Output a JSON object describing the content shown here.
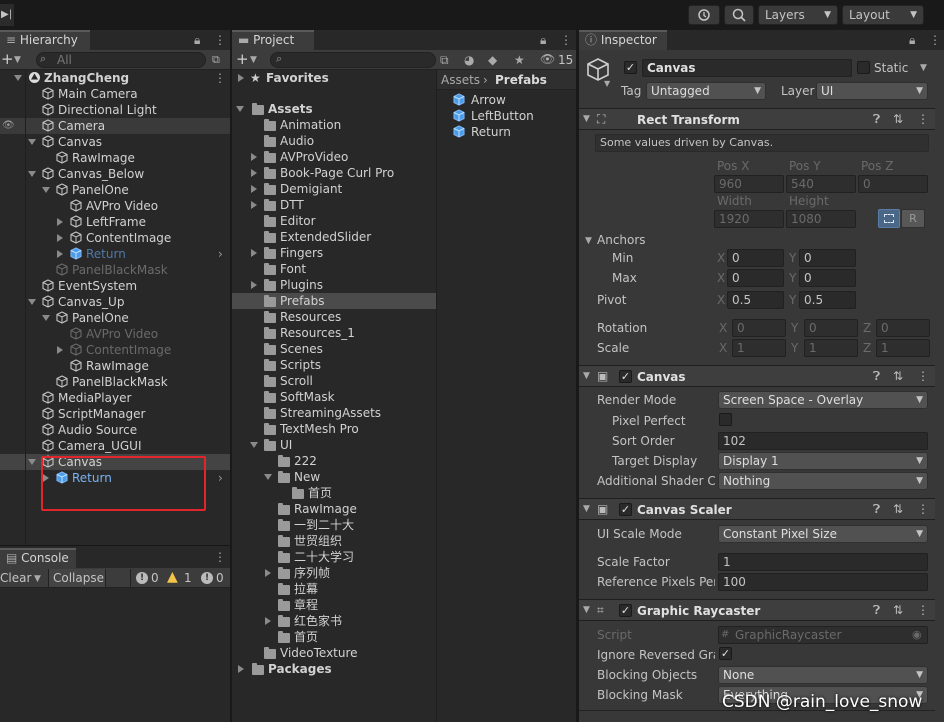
{
  "toolbar": {
    "layers": "Layers",
    "layout": "Layout"
  },
  "hierarchy": {
    "tab": "Hierarchy",
    "search": "All",
    "items": [
      {
        "label": "ZhangCheng",
        "indent": 0,
        "kind": "scene",
        "expanded": true,
        "active": true,
        "bold": true
      },
      {
        "label": "Main Camera",
        "indent": 1,
        "kind": "go",
        "active": true
      },
      {
        "label": "Directional Light",
        "indent": 1,
        "kind": "go",
        "active": true
      },
      {
        "label": "Camera",
        "indent": 1,
        "kind": "go",
        "active": true,
        "hover": true
      },
      {
        "label": "Canvas",
        "indent": 1,
        "kind": "go",
        "expanded": true,
        "active": true
      },
      {
        "label": "RawImage",
        "indent": 2,
        "kind": "go",
        "active": true
      },
      {
        "label": "Canvas_Below",
        "indent": 1,
        "kind": "go",
        "expanded": true,
        "active": true
      },
      {
        "label": "PanelOne",
        "indent": 2,
        "kind": "go",
        "expanded": true,
        "active": true
      },
      {
        "label": "AVPro Video",
        "indent": 3,
        "kind": "go",
        "active": true
      },
      {
        "label": "LeftFrame",
        "indent": 3,
        "kind": "go",
        "collapsed": true,
        "active": true
      },
      {
        "label": "ContentImage",
        "indent": 3,
        "kind": "go",
        "collapsed": true,
        "active": true
      },
      {
        "label": "Return",
        "indent": 3,
        "kind": "prefab",
        "collapsed": true,
        "active": false,
        "more": true
      },
      {
        "label": "PanelBlackMask",
        "indent": 2,
        "kind": "go",
        "active": false
      },
      {
        "label": "EventSystem",
        "indent": 1,
        "kind": "go",
        "active": true
      },
      {
        "label": "Canvas_Up",
        "indent": 1,
        "kind": "go",
        "expanded": true,
        "active": true
      },
      {
        "label": "PanelOne",
        "indent": 2,
        "kind": "go",
        "expanded": true,
        "active": true
      },
      {
        "label": "AVPro Video",
        "indent": 3,
        "kind": "go",
        "active": false
      },
      {
        "label": "ContentImage",
        "indent": 3,
        "kind": "go",
        "collapsed": true,
        "active": false
      },
      {
        "label": "RawImage",
        "indent": 3,
        "kind": "go",
        "active": true
      },
      {
        "label": "PanelBlackMask",
        "indent": 2,
        "kind": "go",
        "active": true
      },
      {
        "label": "MediaPlayer",
        "indent": 1,
        "kind": "go",
        "active": true
      },
      {
        "label": "ScriptManager",
        "indent": 1,
        "kind": "go",
        "active": true
      },
      {
        "label": "Audio Source",
        "indent": 1,
        "kind": "go",
        "active": true
      },
      {
        "label": "Camera_UGUI",
        "indent": 1,
        "kind": "go",
        "active": true
      },
      {
        "label": "Canvas",
        "indent": 1,
        "kind": "go",
        "expanded": true,
        "active": true,
        "selected": true
      },
      {
        "label": "Return",
        "indent": 2,
        "kind": "prefab",
        "collapsed": true,
        "active": true,
        "prefabBlue": true,
        "more": true
      }
    ]
  },
  "console": {
    "tab": "Console",
    "clear": "Clear",
    "collapse": "Collapse",
    "info_count": "0",
    "warn_count": "1",
    "error_count": "0"
  },
  "project": {
    "tab": "Project",
    "count": "15",
    "favorites": "Favorites",
    "assets": "Assets",
    "packages": "Packages",
    "folders": [
      {
        "label": "Animation",
        "indent": 1
      },
      {
        "label": "Audio",
        "indent": 1
      },
      {
        "label": "AVProVideo",
        "indent": 1,
        "arrow": true
      },
      {
        "label": "Book-Page Curl Pro",
        "indent": 1,
        "arrow": true
      },
      {
        "label": "Demigiant",
        "indent": 1,
        "arrow": true
      },
      {
        "label": "DTT",
        "indent": 1,
        "arrow": true
      },
      {
        "label": "Editor",
        "indent": 1
      },
      {
        "label": "ExtendedSlider",
        "indent": 1
      },
      {
        "label": "Fingers",
        "indent": 1,
        "arrow": true
      },
      {
        "label": "Font",
        "indent": 1
      },
      {
        "label": "Plugins",
        "indent": 1,
        "arrow": true
      },
      {
        "label": "Prefabs",
        "indent": 1,
        "selected": true
      },
      {
        "label": "Resources",
        "indent": 1
      },
      {
        "label": "Resources_1",
        "indent": 1
      },
      {
        "label": "Scenes",
        "indent": 1
      },
      {
        "label": "Scripts",
        "indent": 1
      },
      {
        "label": "Scroll",
        "indent": 1
      },
      {
        "label": "SoftMask",
        "indent": 1
      },
      {
        "label": "StreamingAssets",
        "indent": 1
      },
      {
        "label": "TextMesh Pro",
        "indent": 1
      },
      {
        "label": "UI",
        "indent": 1,
        "expanded": true
      },
      {
        "label": "222",
        "indent": 2
      },
      {
        "label": "New",
        "indent": 2,
        "expanded": true
      },
      {
        "label": "首页",
        "indent": 3
      },
      {
        "label": "RawImage",
        "indent": 2
      },
      {
        "label": "一到二十大",
        "indent": 2
      },
      {
        "label": "世贸组织",
        "indent": 2
      },
      {
        "label": "二十大学习",
        "indent": 2
      },
      {
        "label": "序列帧",
        "indent": 2,
        "arrow": true
      },
      {
        "label": "拉幕",
        "indent": 2
      },
      {
        "label": "章程",
        "indent": 2
      },
      {
        "label": "红色家书",
        "indent": 2,
        "arrow": true
      },
      {
        "label": "首页",
        "indent": 2
      },
      {
        "label": "VideoTexture",
        "indent": 1
      }
    ],
    "breadcrumb": [
      "Assets",
      "Prefabs"
    ],
    "files": [
      "Arrow",
      "LeftButton",
      "Return"
    ]
  },
  "inspector": {
    "tab": "Inspector",
    "name": "Canvas",
    "static": "Static",
    "tag_label": "Tag",
    "tag": "Untagged",
    "layer_label": "Layer",
    "layer": "UI",
    "rect": {
      "title": "Rect Transform",
      "note": "Some values driven by Canvas.",
      "posx_l": "Pos X",
      "posy_l": "Pos Y",
      "posz_l": "Pos Z",
      "posx": "960",
      "posy": "540",
      "posz": "0",
      "width_l": "Width",
      "height_l": "Height",
      "width": "1920",
      "height": "1080",
      "r": "R",
      "anchors": "Anchors",
      "min": "Min",
      "max": "Max",
      "pivot": "Pivot",
      "rotation": "Rotation",
      "scale": "Scale",
      "min_x": "0",
      "min_y": "0",
      "max_x": "0",
      "max_y": "0",
      "pivot_x": "0.5",
      "pivot_y": "0.5",
      "rot_x": "0",
      "rot_y": "0",
      "rot_z": "0",
      "scale_x": "1",
      "scale_y": "1",
      "scale_z": "1"
    },
    "canvas": {
      "title": "Canvas",
      "render_mode_l": "Render Mode",
      "render_mode": "Screen Space - Overlay",
      "pixel_perfect_l": "Pixel Perfect",
      "sort_order_l": "Sort Order",
      "sort_order": "102",
      "target_display_l": "Target Display",
      "target_display": "Display 1",
      "shader_l": "Additional Shader Ch",
      "shader": "Nothing"
    },
    "scaler": {
      "title": "Canvas Scaler",
      "mode_l": "UI Scale Mode",
      "mode": "Constant Pixel Size",
      "factor_l": "Scale Factor",
      "factor": "1",
      "ref_l": "Reference Pixels Per",
      "ref": "100"
    },
    "raycaster": {
      "title": "Graphic Raycaster",
      "script_l": "Script",
      "script": "GraphicRaycaster",
      "ignore_l": "Ignore Reversed Grap",
      "block_obj_l": "Blocking Objects",
      "block_obj": "None",
      "block_mask_l": "Blocking Mask",
      "block_mask": "Everything"
    }
  },
  "watermark": "CSDN @rain_love_snow",
  "colors": {
    "accent": "#2c5d87",
    "prefab": "#7bb2f2",
    "highlight_box": "#e0262b",
    "warn": "#f3c34a"
  }
}
